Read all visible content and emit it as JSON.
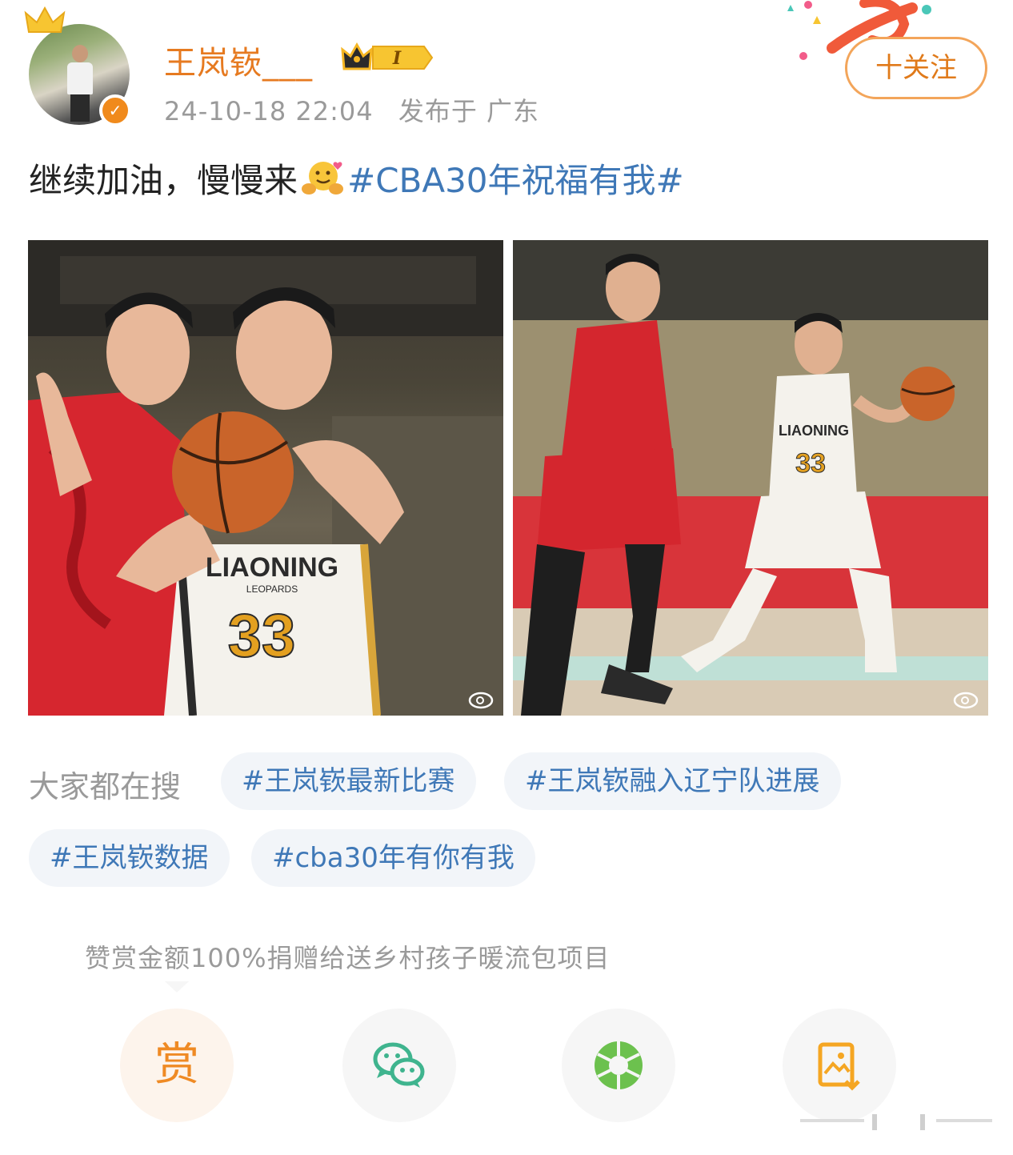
{
  "user": {
    "name": "王岚嵚___",
    "vip_level": "I",
    "timestamp": "24-10-18 22:04",
    "location": "发布于 广东"
  },
  "follow_button": {
    "label": "十关注"
  },
  "post": {
    "text": "继续加油，慢慢来",
    "emoji": "hug-emoji",
    "hashtag": "#CBA30年祝福有我#"
  },
  "images": [
    {
      "name": "photo-player-holding-ball",
      "jersey_team": "LIAONING",
      "jersey_sub": "LEOPARDS",
      "jersey_number": "33"
    },
    {
      "name": "photo-player-dribbling",
      "jersey_team": "LIAONING",
      "jersey_number": "33"
    }
  ],
  "trending": {
    "label": "大家都在搜",
    "tags": [
      "#王岚嵚最新比赛",
      "#王岚嵚融入辽宁队进展",
      "#王岚嵚数据",
      "#cba30年有你有我"
    ]
  },
  "donation_note": "赞赏金额100%捐赠给送乡村孩子暖流包项目",
  "actions": {
    "reward_label": "赏",
    "items": [
      "reward-icon",
      "wechat-icon",
      "moments-icon",
      "save-image-icon"
    ]
  },
  "colors": {
    "username": "#e67a20",
    "hashtag": "#3f78b7",
    "meta": "#9a9a9a",
    "follow_border": "#f3a55a",
    "chip_bg": "#f2f5f9"
  }
}
